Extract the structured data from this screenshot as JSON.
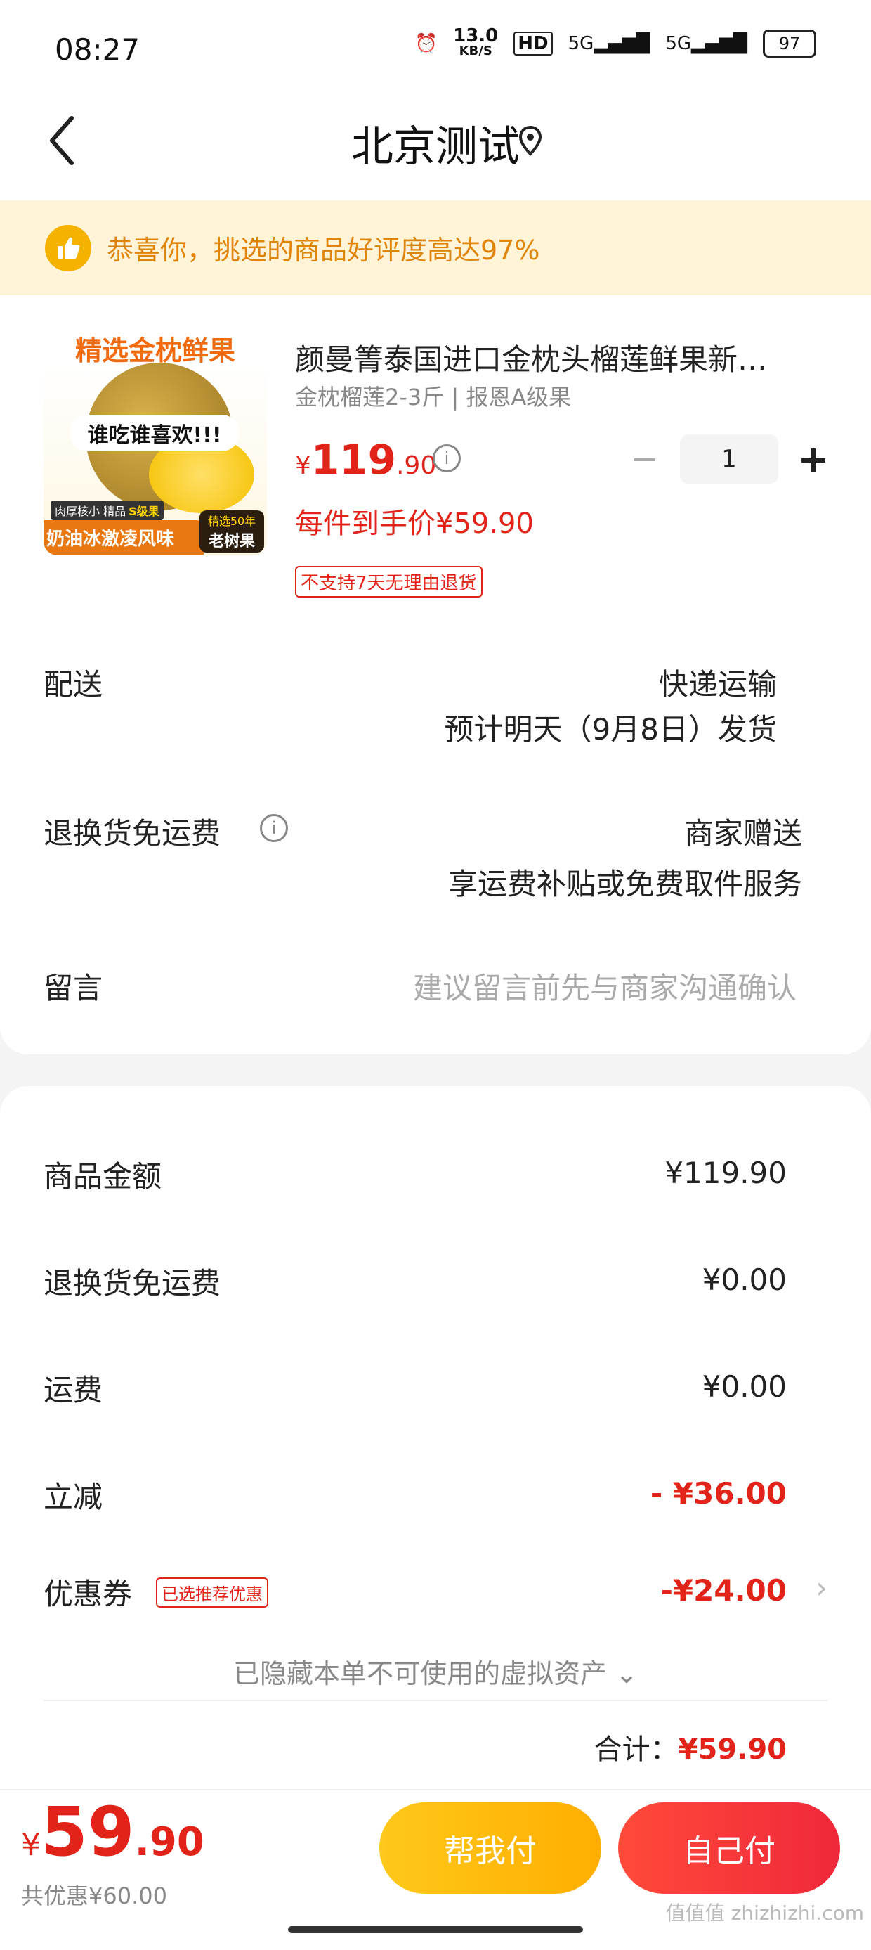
{
  "status": {
    "time": "08:27",
    "net_speed": "13.0",
    "net_unit": "KB/S",
    "hd": "HD",
    "signal1": "5G",
    "signal2": "5G",
    "battery": "97"
  },
  "nav": {
    "title": "北京测试"
  },
  "banner": {
    "text": "恭喜你，挑选的商品好评度高达97%"
  },
  "product": {
    "image_top_text": "精选金枕鲜果",
    "image_mid_text": "谁吃谁喜欢!!!",
    "image_tag1": "肉厚核小 精品",
    "image_tag1_grade": "S级果",
    "image_bottom_text": "奶油冰激凌风味",
    "image_tree_label": "精选50年",
    "image_tree": "老树果",
    "title": "颜曼箐泰国进口金枕头榴莲鲜果新…",
    "spec": "金枕榴莲2-3斤 | 报恩A级果",
    "price_currency": "¥",
    "price_int": "119",
    "price_dec": ".90",
    "quantity": "1",
    "unit_price": "每件到手价¥59.90",
    "no_return": "不支持7天无理由退货"
  },
  "delivery": {
    "label": "配送",
    "method": "快递运输",
    "eta": "预计明天（9月8日）发货"
  },
  "return_shipping": {
    "label": "退换货免运费",
    "value": "商家赠送",
    "desc": "享运费补贴或免费取件服务"
  },
  "message": {
    "label": "留言",
    "placeholder": "建议留言前先与商家沟通确认"
  },
  "summary": {
    "goods_label": "商品金额",
    "goods_value": "¥119.90",
    "return_label": "退换货免运费",
    "return_value": "¥0.00",
    "shipping_label": "运费",
    "shipping_value": "¥0.00",
    "discount_label": "立减",
    "discount_value": "- ¥36.00",
    "coupon_label": "优惠券",
    "coupon_badge": "已选推荐优惠",
    "coupon_value": "-¥24.00",
    "hidden_assets": "已隐藏本单不可使用的虚拟资产 ⌄",
    "total_label": "合计：",
    "total_value": "¥59.90"
  },
  "bottom": {
    "currency": "¥",
    "price_int": "59",
    "price_dec": ".90",
    "saved": "共优惠¥60.00",
    "help_pay": "帮我付",
    "self_pay": "自己付"
  },
  "watermark": "值值值 zhizhizhi.com",
  "colors": {
    "accent_red": "#e2231a",
    "banner_bg": "#fff4d8",
    "help_btn": "#ffb800",
    "self_btn": "#f0283a"
  }
}
